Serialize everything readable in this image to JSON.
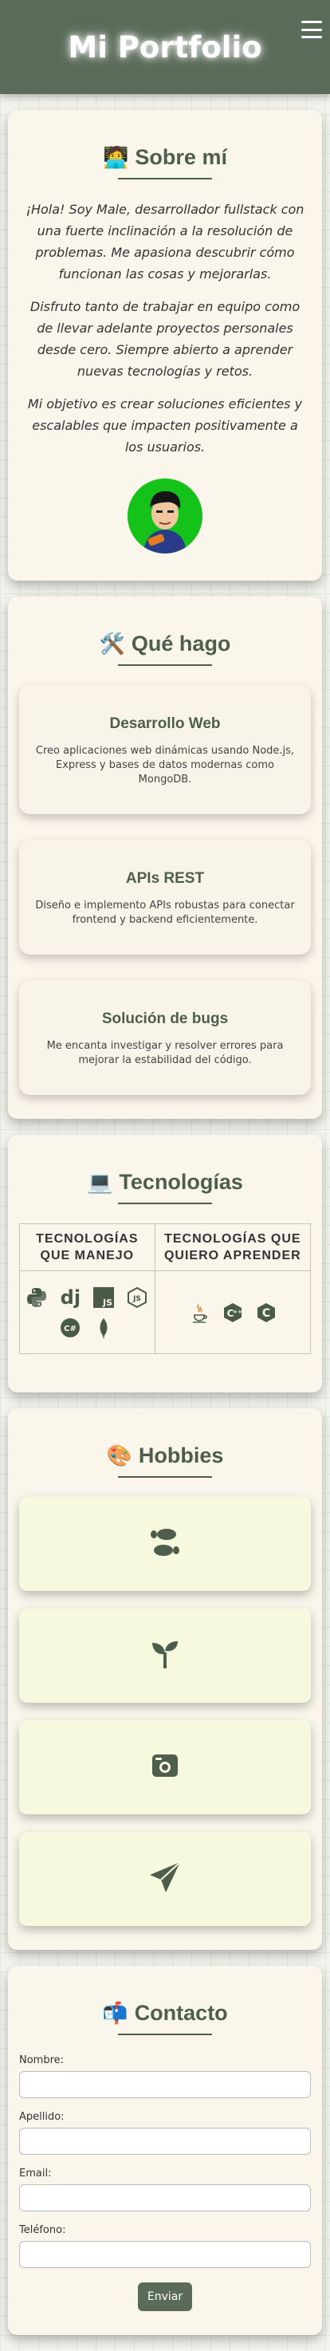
{
  "header": {
    "title": "Mi Portfolio",
    "menu_icon": "hamburger-icon"
  },
  "about": {
    "emoji": "🧑‍💻",
    "title": "Sobre mí",
    "paragraphs": [
      "¡Hola! Soy Male, desarrollador fullstack con una fuerte inclinación a la resolución de problemas. Me apasiona descubrir cómo funcionan las cosas y mejorarlas.",
      "Disfruto tanto de trabajar en equipo como de llevar adelante proyectos personales desde cero. Siempre abierto a aprender nuevas tecnologías y retos.",
      "Mi objetivo es crear soluciones eficientes y escalables que impacten positivamente a los usuarios."
    ],
    "avatar_color": "#15c21a"
  },
  "services": {
    "emoji": "🛠️",
    "title": "Qué hago",
    "cards": [
      {
        "title": "Desarrollo Web",
        "text": "Creo aplicaciones web dinámicas usando Node.js, Express y bases de datos modernas como MongoDB."
      },
      {
        "title": "APIs REST",
        "text": "Diseño e implemento APIs robustas para conectar frontend y backend eficientemente."
      },
      {
        "title": "Solución de bugs",
        "text": "Me encanta investigar y resolver errores para mejorar la estabilidad del código."
      }
    ]
  },
  "tech": {
    "emoji": "💻",
    "title": "Tecnologías",
    "headers": [
      "TECNOLOGÍAS QUE MANEJO",
      "TECNOLOGÍAS QUE QUIERO APRENDER"
    ],
    "known": {
      "js_label": "JS",
      "dj_label": "dj",
      "node_label": "JS",
      "csharp_label": "C#"
    },
    "learn": {
      "cpp_label": "C",
      "c_label": "C"
    }
  },
  "hobbies": {
    "emoji": "🎨",
    "title": "Hobbies",
    "items": [
      "footprints-icon",
      "sprout-icon",
      "camera-icon",
      "paper-plane-icon"
    ]
  },
  "contact": {
    "emoji": "📬",
    "title": "Contacto",
    "fields": {
      "nombre": "Nombre:",
      "apellido": "Apellido:",
      "email": "Email:",
      "telefono": "Teléfono:"
    },
    "submit_label": "Enviar"
  },
  "colors": {
    "primary": "#5a6b59",
    "heading": "#4e5e4d",
    "card_bg": "#fbf6ec",
    "hobby_bg": "#f7f9df"
  }
}
